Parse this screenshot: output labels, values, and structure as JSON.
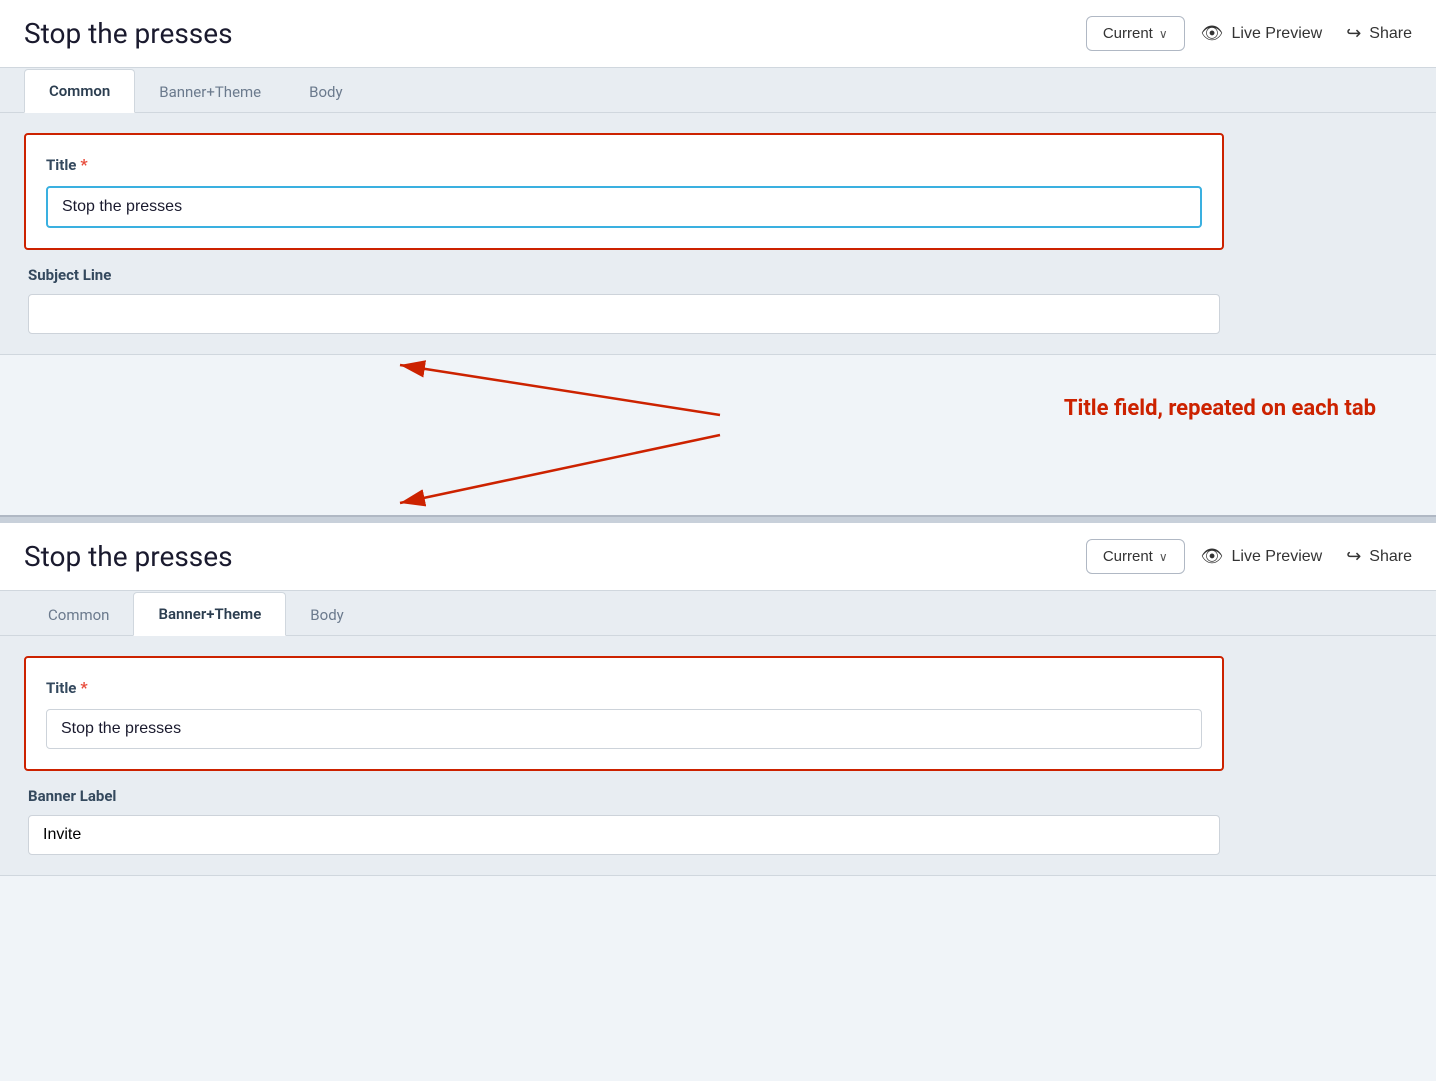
{
  "panel1": {
    "header": {
      "title": "Stop the presses",
      "current_label": "Current",
      "chevron": "∨",
      "live_preview_label": "Live Preview",
      "share_label": "Share"
    },
    "tabs": [
      {
        "id": "common",
        "label": "Common",
        "active": true
      },
      {
        "id": "banner-theme",
        "label": "Banner+Theme",
        "active": false
      },
      {
        "id": "body",
        "label": "Body",
        "active": false
      }
    ],
    "form": {
      "title_label": "Title",
      "title_value": "Stop the presses",
      "subject_line_label": "Subject Line",
      "subject_line_value": "",
      "subject_line_placeholder": ""
    }
  },
  "annotation": {
    "text": "Title field, repeated on each tab"
  },
  "panel2": {
    "header": {
      "title": "Stop the presses",
      "current_label": "Current",
      "chevron": "∨",
      "live_preview_label": "Live Preview",
      "share_label": "Share"
    },
    "tabs": [
      {
        "id": "common",
        "label": "Common",
        "active": false
      },
      {
        "id": "banner-theme",
        "label": "Banner+Theme",
        "active": true
      },
      {
        "id": "body",
        "label": "Body",
        "active": false
      }
    ],
    "form": {
      "title_label": "Title",
      "title_value": "Stop the presses",
      "banner_label": "Banner Label",
      "banner_value": "Invite"
    }
  },
  "icons": {
    "eye": "👁",
    "share": "↪",
    "required_star": "*"
  }
}
